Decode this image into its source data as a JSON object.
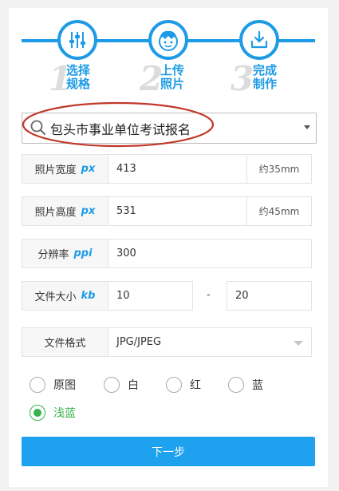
{
  "steps": [
    {
      "num": "1",
      "line1": "选择",
      "line2": "规格",
      "icon": "sliders-icon"
    },
    {
      "num": "2",
      "line1": "上传",
      "line2": "照片",
      "icon": "person-face-icon"
    },
    {
      "num": "3",
      "line1": "完成",
      "line2": "制作",
      "icon": "download-icon"
    }
  ],
  "spec_select": {
    "value": "包头市事业单位考试报名"
  },
  "width_row": {
    "label": "照片宽度",
    "unit": "px",
    "value": "413",
    "suffix": "约35mm"
  },
  "height_row": {
    "label": "照片高度",
    "unit": "px",
    "value": "531",
    "suffix": "约45mm"
  },
  "dpi_row": {
    "label": "分辨率",
    "unit": "ppi",
    "value": "300"
  },
  "size_row": {
    "label": "文件大小",
    "unit": "kb",
    "min": "10",
    "dash": "-",
    "max": "20"
  },
  "format_row": {
    "label": "文件格式",
    "value": "JPG/JPEG"
  },
  "background_options": [
    {
      "label": "原图",
      "checked": false
    },
    {
      "label": "白",
      "checked": false
    },
    {
      "label": "红",
      "checked": false
    },
    {
      "label": "蓝",
      "checked": false
    },
    {
      "label": "浅蓝",
      "checked": true
    }
  ],
  "next_button": {
    "label": "下一步"
  },
  "colors": {
    "accent": "#1e9be6",
    "button": "#1ea1ef",
    "checked": "#35b44a",
    "annotation": "#c0392b"
  }
}
